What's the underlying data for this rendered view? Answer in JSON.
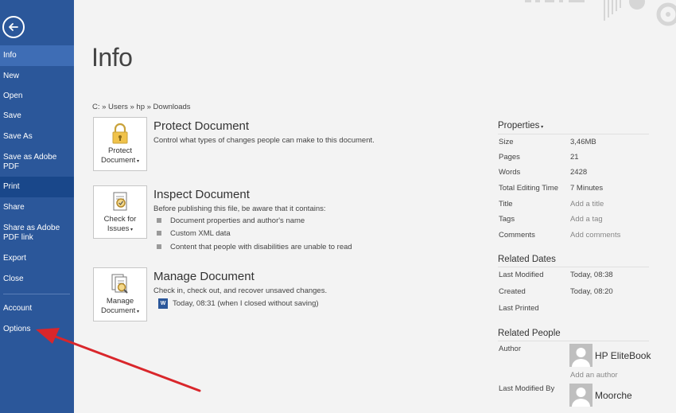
{
  "sidebar": {
    "items": [
      {
        "label": "Info"
      },
      {
        "label": "New"
      },
      {
        "label": "Open"
      },
      {
        "label": "Save"
      },
      {
        "label": "Save As"
      },
      {
        "label": "Save as Adobe PDF"
      },
      {
        "label": "Print"
      },
      {
        "label": "Share"
      },
      {
        "label": "Share as Adobe PDF link"
      },
      {
        "label": "Export"
      },
      {
        "label": "Close"
      },
      {
        "label": "Account"
      },
      {
        "label": "Options"
      }
    ]
  },
  "main": {
    "title": "Info",
    "breadcrumb": "C: » Users » hp » Downloads",
    "protect": {
      "button_line1": "Protect",
      "button_line2": "Document",
      "title": "Protect Document",
      "description": "Control what types of changes people can make to this document."
    },
    "inspect": {
      "button_line1": "Check for",
      "button_line2": "Issues",
      "title": "Inspect Document",
      "description": "Before publishing this file, be aware that it contains:",
      "bullets": [
        "Document properties and author's name",
        "Custom XML data",
        "Content that people with disabilities are unable to read"
      ]
    },
    "manage": {
      "button_line1": "Manage",
      "button_line2": "Document",
      "title": "Manage Document",
      "description": "Check in, check out, and recover unsaved changes.",
      "version": "Today, 08:31 (when I closed without saving)",
      "version_icon_text": "W"
    }
  },
  "properties": {
    "heading": "Properties",
    "rows": [
      {
        "label": "Size",
        "value": "3,46MB"
      },
      {
        "label": "Pages",
        "value": "21"
      },
      {
        "label": "Words",
        "value": "2428"
      },
      {
        "label": "Total Editing Time",
        "value": "7 Minutes"
      },
      {
        "label": "Title",
        "value": "Add a title"
      },
      {
        "label": "Tags",
        "value": "Add a tag"
      },
      {
        "label": "Comments",
        "value": "Add comments"
      }
    ],
    "related_dates": {
      "heading": "Related Dates",
      "rows": [
        {
          "label": "Last Modified",
          "value": "Today, 08:38"
        },
        {
          "label": "Created",
          "value": "Today, 08:20"
        },
        {
          "label": "Last Printed",
          "value": ""
        }
      ]
    },
    "related_people": {
      "heading": "Related People",
      "author_label": "Author",
      "author_name": "HP EliteBook",
      "add_author": "Add an author",
      "last_modified_by_label": "Last Modified By",
      "last_modified_by_name": "Moorche"
    }
  },
  "colors": {
    "sidebar": "#2b579a",
    "sidebar_selected": "#3e6db5",
    "annotation_arrow": "#d9262b"
  }
}
